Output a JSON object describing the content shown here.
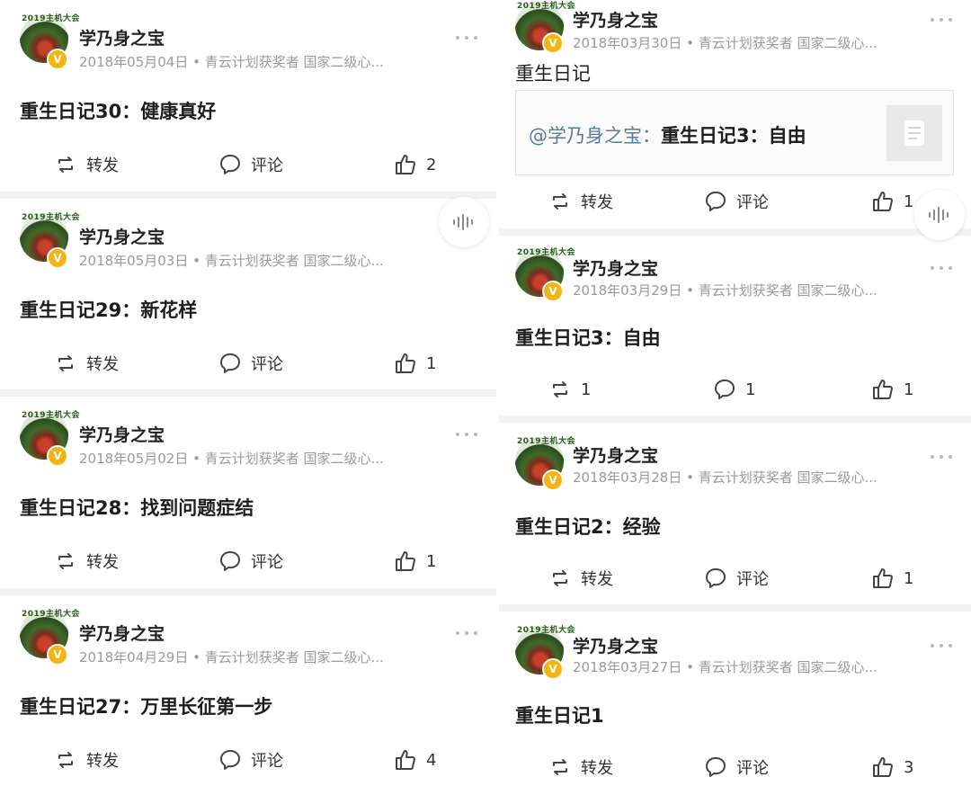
{
  "left_posts": [
    {
      "username": "学乃身之宝",
      "meta": "2018年05月04日 • 青云计划获奖者 国家二级心...",
      "title": "重生日记30：健康真好",
      "repost": "转发",
      "comment": "评论",
      "likes": "2",
      "avatar_text": "2019主机大会"
    },
    {
      "username": "学乃身之宝",
      "meta": "2018年05月03日 • 青云计划获奖者 国家二级心...",
      "title": "重生日记29：新花样",
      "repost": "转发",
      "comment": "评论",
      "likes": "1",
      "avatar_text": "2019主机大会"
    },
    {
      "username": "学乃身之宝",
      "meta": "2018年05月02日 • 青云计划获奖者 国家二级心...",
      "title": "重生日记28：找到问题症结",
      "repost": "转发",
      "comment": "评论",
      "likes": "1",
      "avatar_text": "2019主机大会"
    },
    {
      "username": "学乃身之宝",
      "meta": "2018年04月29日 • 青云计划获奖者 国家二级心...",
      "title": "重生日记27：万里长征第一步",
      "repost": "转发",
      "comment": "评论",
      "likes": "4",
      "avatar_text": "2019主机大会"
    }
  ],
  "right_posts": [
    {
      "username": "学乃身之宝",
      "meta": "2018年03月30日 • 青云计划获奖者 国家二级心...",
      "text": "重生日记",
      "quote_user": "@学乃身之宝：",
      "quote_title": "重生日记3：自由",
      "repost": "转发",
      "comment": "评论",
      "likes": "1",
      "avatar_text": "2019主机大会"
    },
    {
      "username": "学乃身之宝",
      "meta": "2018年03月29日 • 青云计划获奖者 国家二级心...",
      "title": "重生日记3：自由",
      "repost": "1",
      "comment": "1",
      "likes": "1",
      "avatar_text": "2019主机大会"
    },
    {
      "username": "学乃身之宝",
      "meta": "2018年03月28日 • 青云计划获奖者 国家二级心...",
      "title": "重生日记2：经验",
      "repost": "转发",
      "comment": "评论",
      "likes": "1",
      "avatar_text": "2019主机大会"
    },
    {
      "username": "学乃身之宝",
      "meta": "2018年03月27日 • 青云计划获奖者 国家二级心...",
      "title": "重生日记1",
      "repost": "转发",
      "comment": "评论",
      "likes": "3",
      "avatar_text": "2019主机大会"
    }
  ],
  "badge_letter": "V",
  "icons": {
    "repost": "repost-icon",
    "comment": "comment-icon",
    "like": "thumbs-up-icon",
    "more": "more-options-icon",
    "voice": "voice-wave-icon",
    "document": "document-icon"
  },
  "colors": {
    "badge": "#f2b514",
    "meta": "#9a9a9a",
    "quote_user": "#5a7b97",
    "separator": "#f2f2f2"
  }
}
